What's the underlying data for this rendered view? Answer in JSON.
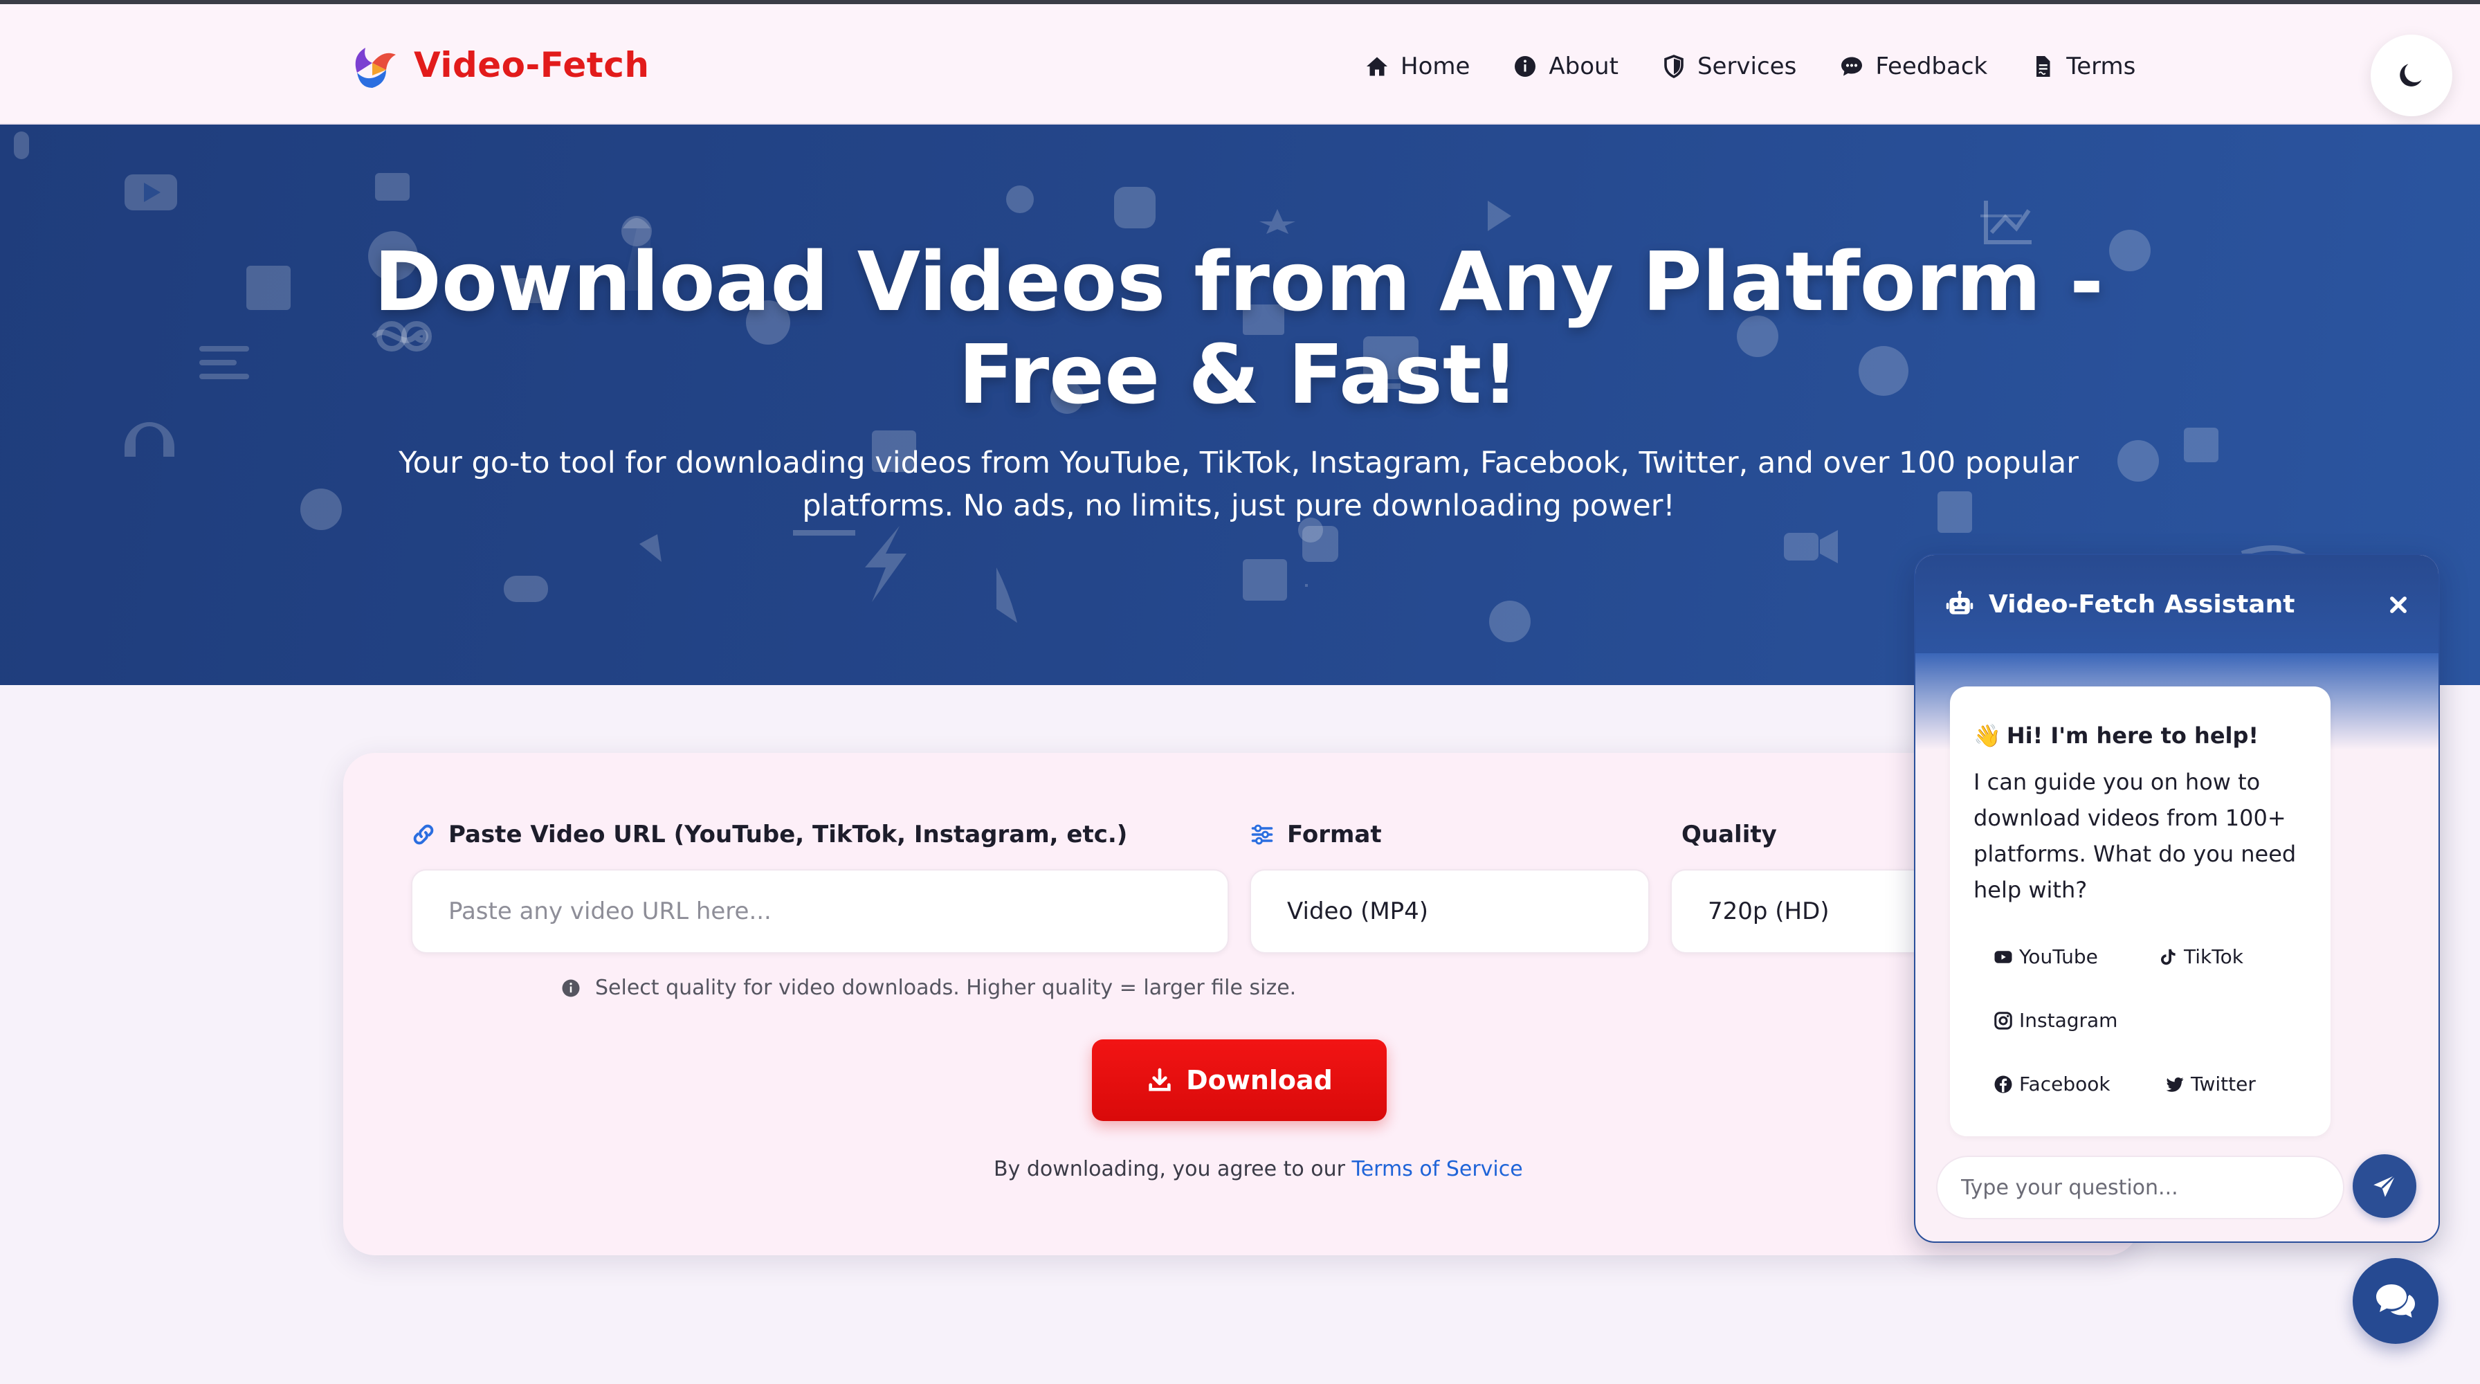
{
  "header": {
    "brand_name": "Video-Fetch",
    "nav": [
      {
        "label": "Home",
        "icon": "home-icon"
      },
      {
        "label": "About",
        "icon": "info-circle-icon"
      },
      {
        "label": "Services",
        "icon": "shield-icon"
      },
      {
        "label": "Feedback",
        "icon": "comment-dots-icon"
      },
      {
        "label": "Terms",
        "icon": "file-contract-icon"
      }
    ],
    "theme_toggle_icon": "moon-icon"
  },
  "hero": {
    "title": "Download Videos from Any Platform - Free & Fast!",
    "subtitle": "Your go-to tool for downloading videos from YouTube, TikTok, Instagram, Facebook, Twitter, and over 100 popular platforms. No ads, no limits, just pure downloading power!"
  },
  "form": {
    "url_label": "Paste Video URL (YouTube, TikTok, Instagram, etc.)",
    "url_placeholder": "Paste any video URL here...",
    "format_label": "Format",
    "format_value": "Video (MP4)",
    "quality_label": "Quality",
    "quality_value": "720p (HD)",
    "hint": "Select quality for video downloads. Higher quality = larger file size.",
    "download_label": "Download",
    "agree_prefix": "By downloading, you agree to our ",
    "agree_link": "Terms of Service"
  },
  "chat": {
    "title": "Video-Fetch Assistant",
    "greeting_emoji": "👋",
    "greeting": "Hi! I'm here to help!",
    "message": "I can guide you on how to download videos from 100+ platforms. What do you need help with?",
    "chips": [
      {
        "label": "YouTube",
        "icon": "youtube-icon"
      },
      {
        "label": "TikTok",
        "icon": "tiktok-icon"
      },
      {
        "label": "Instagram",
        "icon": "instagram-icon"
      },
      {
        "label": "Facebook",
        "icon": "facebook-icon"
      },
      {
        "label": "Twitter",
        "icon": "twitter-icon"
      }
    ],
    "input_placeholder": "Type your question..."
  },
  "colors": {
    "brand_red": "#e21b1b",
    "hero_blue": "#24468a",
    "chat_blue": "#2b4e95",
    "link_blue": "#1f64d8"
  }
}
